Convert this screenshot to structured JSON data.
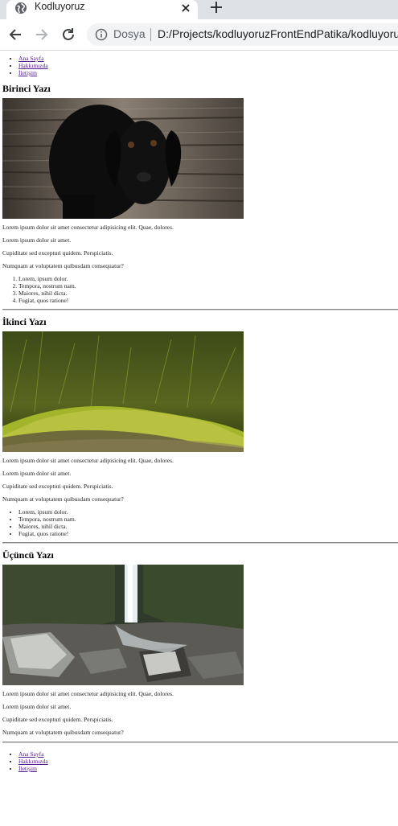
{
  "browser": {
    "tab_title": "Kodluyoruz",
    "security_label": "Dosya",
    "url": "D:/Projects/kodluyoruzFrontEndPatika/kodluyoruz"
  },
  "nav_top": [
    "Ana Sayfa",
    "Hakkımızda",
    "İletişim"
  ],
  "articles": [
    {
      "title": "Birinci Yazı",
      "image": "black-puppy-photo",
      "paragraphs": [
        "Lorem ipsum dolor sit amet consectetur adipisicing elit. Quae, dolores.",
        "Lorem ipsum dolor sit amet.",
        "Cupiditate sed excepturi quidem. Perspiciatis.",
        "Numquam at voluptatem quibusdam consequatur?"
      ],
      "list_type": "ordered",
      "list": [
        "Lorem, ipsum dolor.",
        "Tempora, nostrum nam.",
        "Maiores, nihil dicta.",
        "Fugiat, quos ratione!"
      ]
    },
    {
      "title": "İkinci Yazı",
      "image": "forest-moss-photo",
      "paragraphs": [
        "Lorem ipsum dolor sit amet consectetur adipisicing elit. Quae, dolores.",
        "Lorem ipsum dolor sit amet.",
        "Cupiditate sed excepturi quidem. Perspiciatis.",
        "Numquam at voluptatem quibusdam consequatur?"
      ],
      "list_type": "unordered",
      "list": [
        "Lorem, ipsum dolor.",
        "Tempora, nostrum nam.",
        "Maiores, nihil dicta.",
        "Fugiat, quos ratione!"
      ]
    },
    {
      "title": "Üçüncü Yazı",
      "image": "waterfall-rocks-photo",
      "paragraphs": [
        "Lorem ipsum dolor sit amet consectetur adipisicing elit. Quae, dolores.",
        "Lorem ipsum dolor sit amet.",
        "Cupiditate sed excepturi quidem. Perspiciatis.",
        "Numquam at voluptatem quibusdam consequatur?"
      ]
    }
  ],
  "nav_bottom": [
    "Ana Sayfa",
    "Hakkımızda",
    "İletişim"
  ],
  "colors": {
    "link": "#551a8b",
    "chrome_bg": "#dee1e6",
    "omnibox_bg": "#f1f3f4"
  }
}
